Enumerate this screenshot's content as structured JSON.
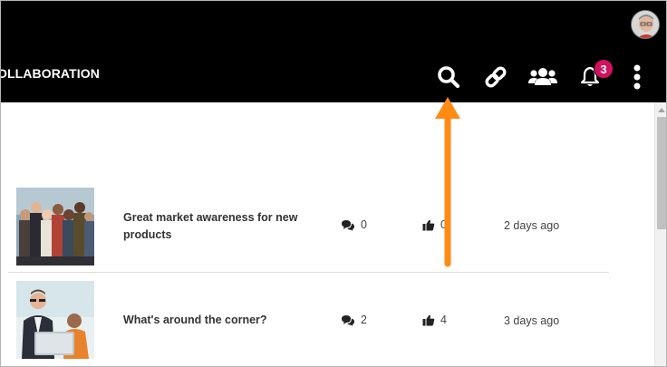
{
  "header": {
    "title": "OLLABORATION",
    "notification_count": "3",
    "icons": [
      "search-icon",
      "link-icon",
      "users-icon",
      "bell-icon",
      "more-vertical-icon"
    ]
  },
  "colors": {
    "header_bg": "#000000",
    "badge": "#d4115f",
    "annotation_arrow": "#ff8a14"
  },
  "feed": [
    {
      "title": "Great market awareness for new products",
      "comments": "0",
      "likes": "0",
      "time": "2 days ago"
    },
    {
      "title": "What's around the corner?",
      "comments": "2",
      "likes": "4",
      "time": "3 days ago"
    }
  ]
}
